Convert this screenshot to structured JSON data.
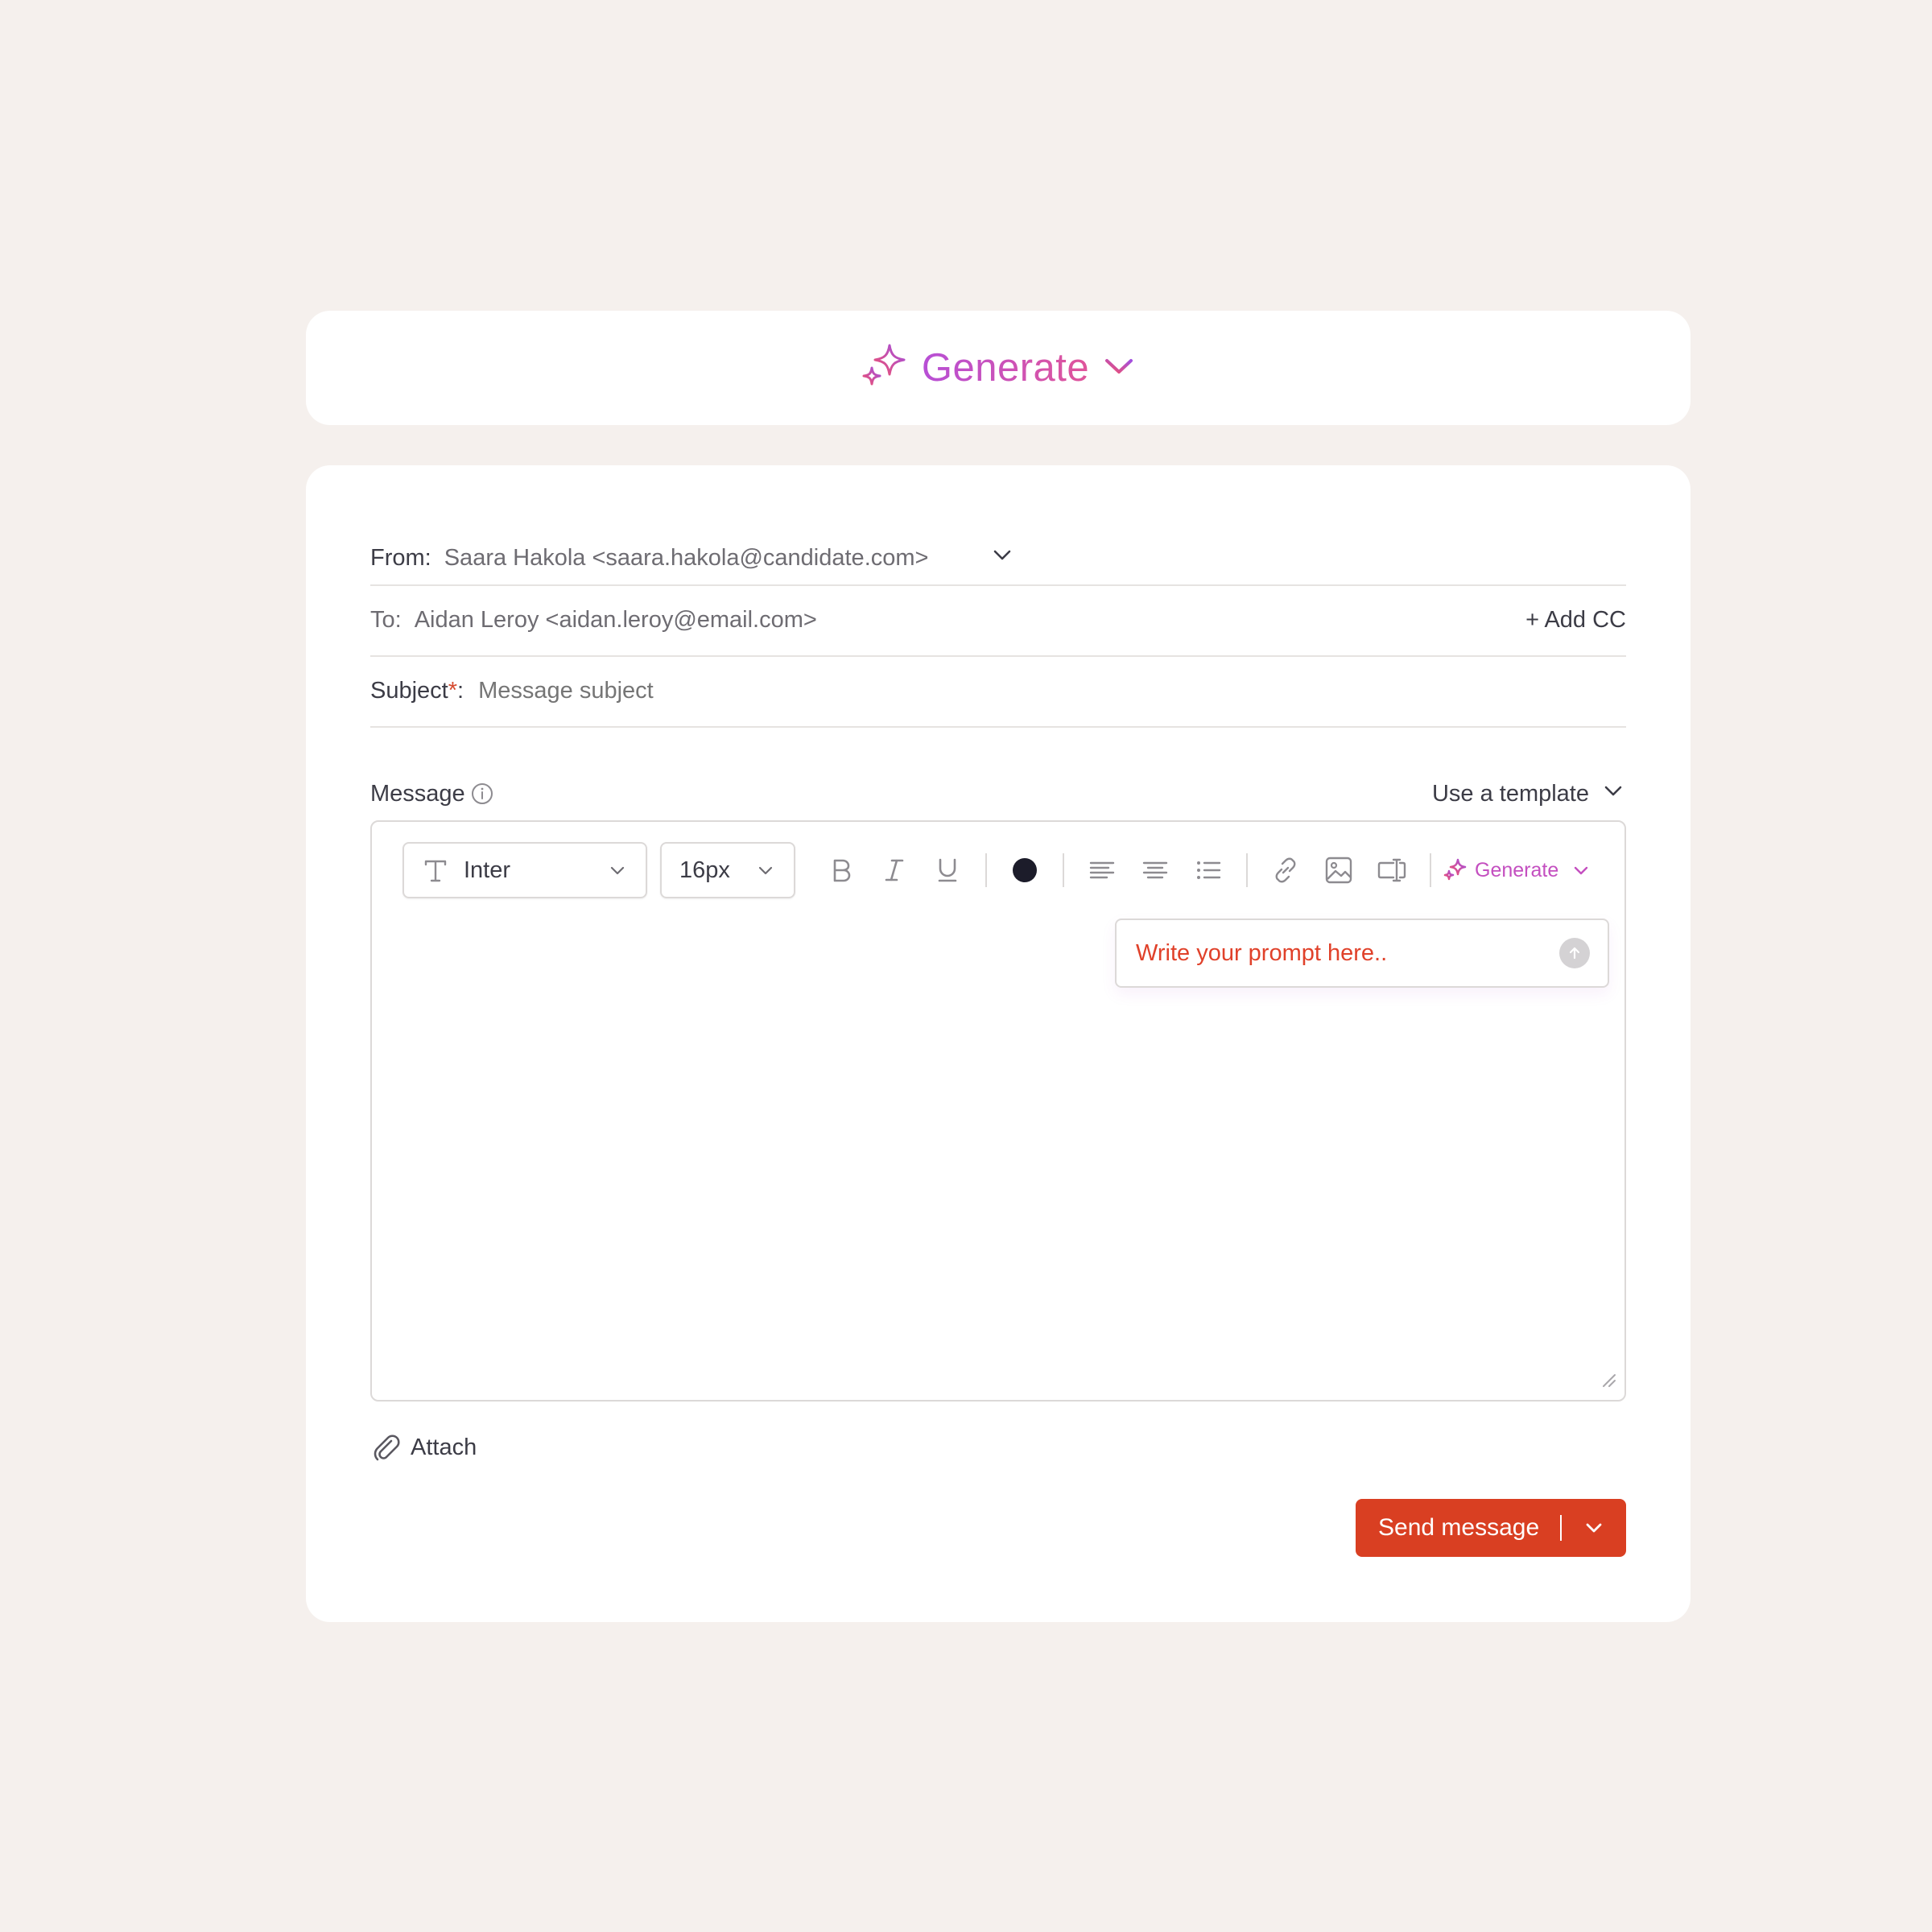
{
  "header": {
    "generate_label": "Generate",
    "gradient_start": "#b74fd6",
    "gradient_end": "#e0559a"
  },
  "compose": {
    "from": {
      "label": "From:",
      "value": "Saara Hakola <saara.hakola@candidate.com>"
    },
    "to": {
      "label": "To:",
      "value": "Aidan Leroy <aidan.leroy@email.com>",
      "add_cc_label": "+ Add CC"
    },
    "subject": {
      "label": "Subject",
      "required_mark": "*",
      "colon": ":",
      "placeholder": "Message subject"
    },
    "message": {
      "label": "Message",
      "info_icon": "info-icon",
      "template_label": "Use a template"
    },
    "toolbar": {
      "font_value": "Inter",
      "size_value": "16px",
      "text_color": "#1c1c2a",
      "icons": [
        "font-type-icon",
        "bold-icon",
        "italic-icon",
        "underline-icon",
        "color-swatch",
        "align-left-icon",
        "align-center-icon",
        "bullet-list-icon",
        "link-icon",
        "image-icon",
        "variable-icon",
        "sparkle-icon"
      ],
      "generate_label": "Generate"
    },
    "prompt": {
      "placeholder": "Write your prompt here.."
    },
    "attach_label": "Attach",
    "send": {
      "label": "Send message",
      "color": "#d93f22"
    }
  }
}
